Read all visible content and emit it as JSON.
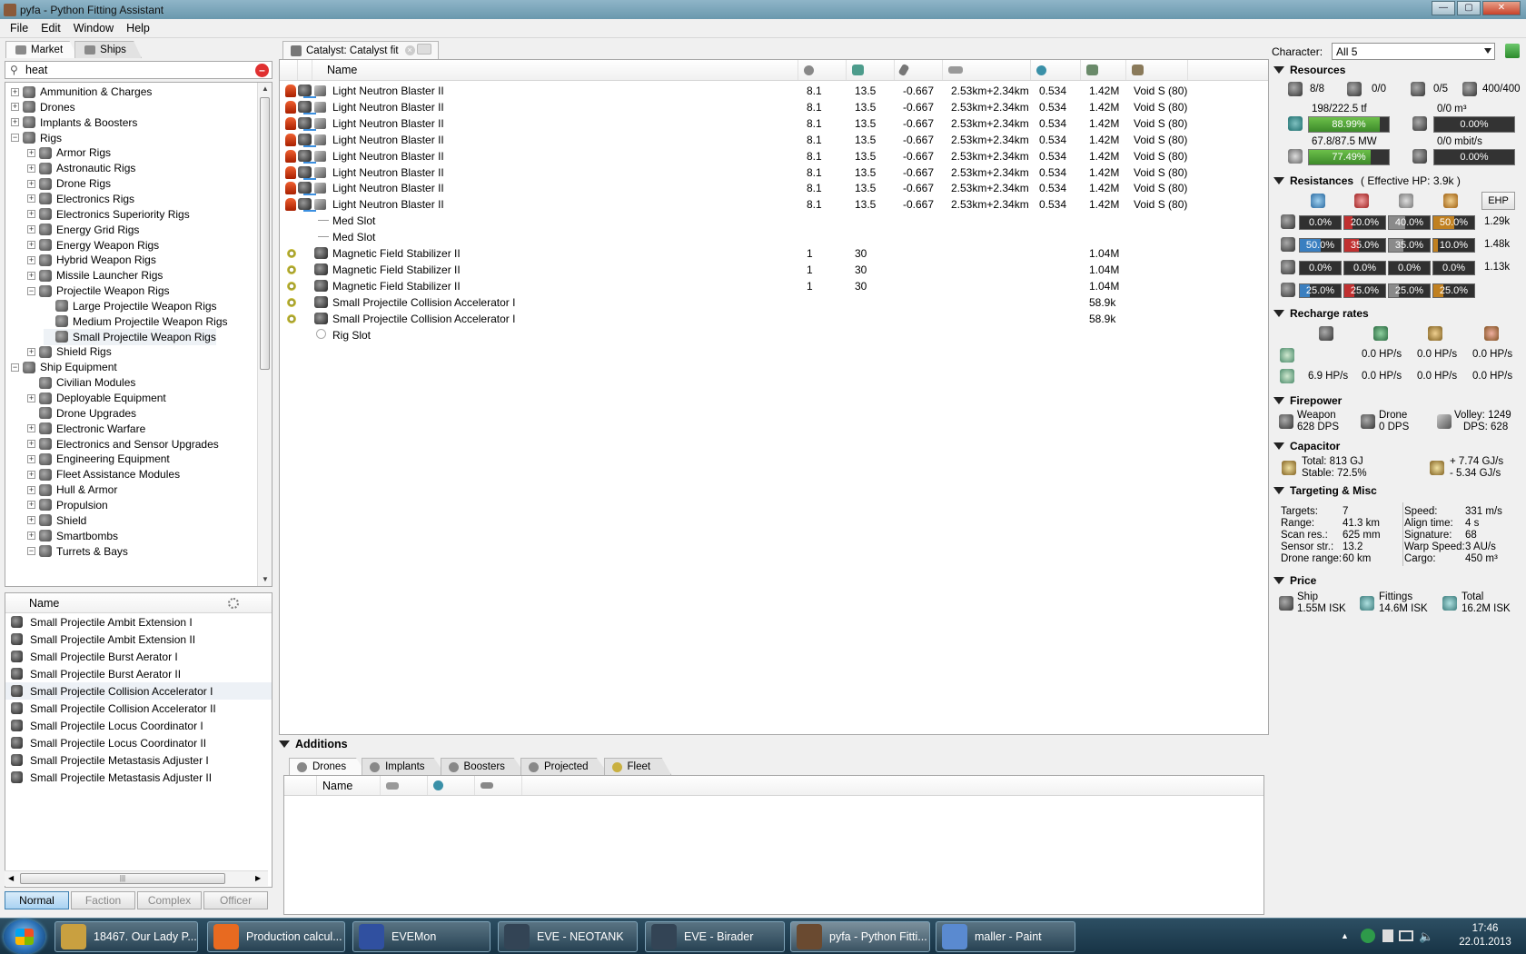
{
  "window": {
    "title": "pyfa - Python Fitting Assistant"
  },
  "menu": [
    "File",
    "Edit",
    "Window",
    "Help"
  ],
  "left": {
    "tabs": [
      "Market",
      "Ships"
    ],
    "search_value": "heat",
    "tree": [
      {
        "label": "Ammunition & Charges",
        "level": 0,
        "exp": "+"
      },
      {
        "label": "Drones",
        "level": 0,
        "exp": "+"
      },
      {
        "label": "Implants & Boosters",
        "level": 0,
        "exp": "+"
      },
      {
        "label": "Rigs",
        "level": 0,
        "exp": "-"
      },
      {
        "label": "Armor Rigs",
        "level": 1,
        "exp": "+"
      },
      {
        "label": "Astronautic Rigs",
        "level": 1,
        "exp": "+"
      },
      {
        "label": "Drone Rigs",
        "level": 1,
        "exp": "+"
      },
      {
        "label": "Electronics Rigs",
        "level": 1,
        "exp": "+"
      },
      {
        "label": "Electronics Superiority Rigs",
        "level": 1,
        "exp": "+"
      },
      {
        "label": "Energy Grid Rigs",
        "level": 1,
        "exp": "+"
      },
      {
        "label": "Energy Weapon Rigs",
        "level": 1,
        "exp": "+"
      },
      {
        "label": "Hybrid Weapon Rigs",
        "level": 1,
        "exp": "+"
      },
      {
        "label": "Missile Launcher Rigs",
        "level": 1,
        "exp": "+"
      },
      {
        "label": "Projectile Weapon Rigs",
        "level": 1,
        "exp": "-"
      },
      {
        "label": "Large Projectile Weapon Rigs",
        "level": 2,
        "exp": ""
      },
      {
        "label": "Medium Projectile Weapon Rigs",
        "level": 2,
        "exp": ""
      },
      {
        "label": "Small Projectile Weapon Rigs",
        "level": 2,
        "exp": "",
        "selected": true
      },
      {
        "label": "Shield Rigs",
        "level": 1,
        "exp": "+"
      },
      {
        "label": "Ship Equipment",
        "level": 0,
        "exp": "-"
      },
      {
        "label": "Civilian Modules",
        "level": 1,
        "exp": ""
      },
      {
        "label": "Deployable Equipment",
        "level": 1,
        "exp": "+"
      },
      {
        "label": "Drone Upgrades",
        "level": 1,
        "exp": ""
      },
      {
        "label": "Electronic Warfare",
        "level": 1,
        "exp": "+"
      },
      {
        "label": "Electronics and Sensor Upgrades",
        "level": 1,
        "exp": "+"
      },
      {
        "label": "Engineering Equipment",
        "level": 1,
        "exp": "+"
      },
      {
        "label": "Fleet Assistance Modules",
        "level": 1,
        "exp": "+"
      },
      {
        "label": "Hull & Armor",
        "level": 1,
        "exp": "+"
      },
      {
        "label": "Propulsion",
        "level": 1,
        "exp": "+"
      },
      {
        "label": "Shield",
        "level": 1,
        "exp": "+"
      },
      {
        "label": "Smartbombs",
        "level": 1,
        "exp": "+"
      },
      {
        "label": "Turrets & Bays",
        "level": 1,
        "exp": "-"
      }
    ],
    "items_header": "Name",
    "items": [
      "Small Projectile Ambit Extension I",
      "Small Projectile Ambit Extension II",
      "Small Projectile Burst Aerator I",
      "Small Projectile Burst Aerator II",
      "Small Projectile Collision Accelerator I",
      "Small Projectile Collision Accelerator II",
      "Small Projectile Locus Coordinator I",
      "Small Projectile Locus Coordinator II",
      "Small Projectile Metastasis Adjuster I",
      "Small Projectile Metastasis Adjuster II"
    ],
    "selected_item": 4,
    "meta_buttons": [
      "Normal",
      "Faction",
      "Complex",
      "Officer"
    ]
  },
  "fit": {
    "tab_label": "Catalyst: Catalyst fit",
    "name_header": "Name",
    "rows": [
      {
        "type": "high",
        "name": "Light Neutron Blaster II",
        "c1": "8.1",
        "c2": "13.5",
        "c3": "-0.667",
        "range": "2.53km+2.34km",
        "c5": "0.534",
        "price": "1.42M",
        "charge": "Void S (80)"
      },
      {
        "type": "high",
        "name": "Light Neutron Blaster II",
        "c1": "8.1",
        "c2": "13.5",
        "c3": "-0.667",
        "range": "2.53km+2.34km",
        "c5": "0.534",
        "price": "1.42M",
        "charge": "Void S (80)"
      },
      {
        "type": "high",
        "name": "Light Neutron Blaster II",
        "c1": "8.1",
        "c2": "13.5",
        "c3": "-0.667",
        "range": "2.53km+2.34km",
        "c5": "0.534",
        "price": "1.42M",
        "charge": "Void S (80)"
      },
      {
        "type": "high",
        "name": "Light Neutron Blaster II",
        "c1": "8.1",
        "c2": "13.5",
        "c3": "-0.667",
        "range": "2.53km+2.34km",
        "c5": "0.534",
        "price": "1.42M",
        "charge": "Void S (80)"
      },
      {
        "type": "high",
        "name": "Light Neutron Blaster II",
        "c1": "8.1",
        "c2": "13.5",
        "c3": "-0.667",
        "range": "2.53km+2.34km",
        "c5": "0.534",
        "price": "1.42M",
        "charge": "Void S (80)"
      },
      {
        "type": "high",
        "name": "Light Neutron Blaster II",
        "c1": "8.1",
        "c2": "13.5",
        "c3": "-0.667",
        "range": "2.53km+2.34km",
        "c5": "0.534",
        "price": "1.42M",
        "charge": "Void S (80)"
      },
      {
        "type": "high",
        "name": "Light Neutron Blaster II",
        "c1": "8.1",
        "c2": "13.5",
        "c3": "-0.667",
        "range": "2.53km+2.34km",
        "c5": "0.534",
        "price": "1.42M",
        "charge": "Void S (80)"
      },
      {
        "type": "high",
        "name": "Light Neutron Blaster II",
        "c1": "8.1",
        "c2": "13.5",
        "c3": "-0.667",
        "range": "2.53km+2.34km",
        "c5": "0.534",
        "price": "1.42M",
        "charge": "Void S (80)"
      },
      {
        "type": "empty",
        "name": "Med Slot"
      },
      {
        "type": "empty",
        "name": "Med Slot"
      },
      {
        "type": "low",
        "name": "Magnetic Field Stabilizer II",
        "c1": "1",
        "c2": "30",
        "price": "1.04M"
      },
      {
        "type": "low",
        "name": "Magnetic Field Stabilizer II",
        "c1": "1",
        "c2": "30",
        "price": "1.04M"
      },
      {
        "type": "low",
        "name": "Magnetic Field Stabilizer II",
        "c1": "1",
        "c2": "30",
        "price": "1.04M"
      },
      {
        "type": "rig",
        "name": "Small Projectile Collision Accelerator I",
        "price": "58.9k"
      },
      {
        "type": "rig",
        "name": "Small Projectile Collision Accelerator I",
        "price": "58.9k"
      },
      {
        "type": "rigempty",
        "name": "Rig Slot"
      }
    ]
  },
  "additions": {
    "title": "Additions",
    "tabs": [
      "Drones",
      "Implants",
      "Boosters",
      "Projected",
      "Fleet"
    ],
    "name_header": "Name"
  },
  "right": {
    "character_label": "Character:",
    "character_value": "All 5",
    "resources": {
      "title": "Resources",
      "turret": "8/8",
      "launcher": "0/0",
      "calibration_slots": "0/5",
      "calibration": "400/400",
      "cpu_text": "198/222.5 tf",
      "cpu_pct": "88.99%",
      "cpu_fill": 0.8899,
      "drone_bay": "0/0 m³",
      "drone_bay_pct": "0.00%",
      "pg_text": "67.8/87.5 MW",
      "pg_pct": "77.49%",
      "pg_fill": 0.7749,
      "bandwidth": "0/0 mbit/s",
      "bandwidth_pct": "0.00%"
    },
    "resistances": {
      "title": "Resistances",
      "ehp_total": "( Effective HP: 3.9k )",
      "ehp_button": "EHP",
      "rows": [
        {
          "vals": [
            "0.0%",
            "20.0%",
            "40.0%",
            "50.0%"
          ],
          "fills": [
            0.0,
            0.2,
            0.4,
            0.5
          ],
          "hp": "1.29k"
        },
        {
          "vals": [
            "50.0%",
            "35.0%",
            "35.0%",
            "10.0%"
          ],
          "fills": [
            0.5,
            0.35,
            0.35,
            0.1
          ],
          "hp": "1.48k"
        },
        {
          "vals": [
            "0.0%",
            "0.0%",
            "0.0%",
            "0.0%"
          ],
          "fills": [
            0,
            0,
            0,
            0
          ],
          "hp": "1.13k"
        },
        {
          "vals": [
            "25.0%",
            "25.0%",
            "25.0%",
            "25.0%"
          ],
          "fills": [
            0.25,
            0.25,
            0.25,
            0.25
          ],
          "hp": ""
        }
      ],
      "colors": [
        "#3a7fc0",
        "#c03030",
        "#8a8a8a",
        "#c08020"
      ]
    },
    "recharge": {
      "title": "Recharge rates",
      "row1": [
        "0.0 HP/s",
        "0.0 HP/s",
        "0.0 HP/s"
      ],
      "row2": [
        "6.9 HP/s",
        "0.0 HP/s",
        "0.0 HP/s",
        "0.0 HP/s"
      ]
    },
    "firepower": {
      "title": "Firepower",
      "weapon_label": "Weapon",
      "weapon_dps": "628 DPS",
      "drone_label": "Drone",
      "drone_dps": "0 DPS",
      "volley": "Volley: 1249",
      "dps": "DPS: 628"
    },
    "capacitor": {
      "title": "Capacitor",
      "total": "Total: 813 GJ",
      "stable": "Stable: 72.5%",
      "plus": "+ 7.74 GJ/s",
      "minus": "- 5.34 GJ/s"
    },
    "targeting": {
      "title": "Targeting & Misc",
      "left": [
        [
          "Targets:",
          "7"
        ],
        [
          "Range:",
          "41.3 km"
        ],
        [
          "Scan res.:",
          "625 mm"
        ],
        [
          "Sensor str.:",
          "13.2"
        ],
        [
          "Drone range:",
          "60 km"
        ]
      ],
      "right": [
        [
          "Speed:",
          "331 m/s"
        ],
        [
          "Align time:",
          "4 s"
        ],
        [
          "Signature:",
          "68"
        ],
        [
          "Warp Speed:",
          "3 AU/s"
        ],
        [
          "Cargo:",
          "450 m³"
        ]
      ]
    },
    "price": {
      "title": "Price",
      "ship_label": "Ship",
      "ship": "1.55M ISK",
      "fittings_label": "Fittings",
      "fittings": "14.6M ISK",
      "total_label": "Total",
      "total": "16.2M ISK"
    }
  },
  "taskbar": {
    "items": [
      "18467. Our Lady P...",
      "Production calcul...",
      "EVEMon",
      "EVE - NEOTANK",
      "EVE - Birader",
      "pyfa - Python Fitti...",
      "maller - Paint"
    ],
    "active": 5,
    "time": "17:46",
    "date": "22.01.2013"
  }
}
